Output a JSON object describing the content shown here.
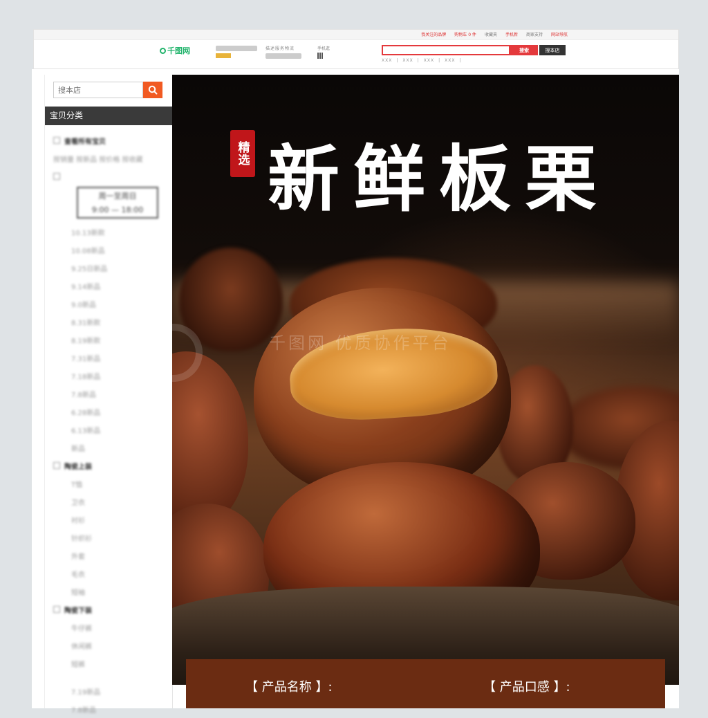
{
  "header": {
    "top_links": [
      "我关注的品牌",
      "购物车 0 件",
      "收藏夹",
      "手机新",
      "商家支持",
      "网站导航"
    ],
    "logo_text": "千图网",
    "store_service_label": "描述服务物流",
    "mobile_label": "手机逛",
    "search_placeholder": "",
    "search_button": "搜索",
    "store_search_button": "搜本店",
    "hot_words": [
      "XXX",
      "XXX",
      "XXX",
      "XXX"
    ]
  },
  "sidebar": {
    "search_placeholder": "搜本店",
    "category_title": "宝贝分类",
    "items": [
      {
        "label": "查看所有宝贝",
        "type": "head"
      },
      {
        "label": "按销量 按新品 按价格 按收藏",
        "type": "plain"
      },
      {
        "label": "",
        "type": "box"
      },
      {
        "label": "10.13新款",
        "type": "sub"
      },
      {
        "label": "10.08新品",
        "type": "sub"
      },
      {
        "label": "9.25日新品",
        "type": "sub"
      },
      {
        "label": "9.14新品",
        "type": "sub"
      },
      {
        "label": "9.0新品",
        "type": "sub"
      },
      {
        "label": "8.31新款",
        "type": "sub"
      },
      {
        "label": "8.19新款",
        "type": "sub"
      },
      {
        "label": "7.31新品",
        "type": "sub"
      },
      {
        "label": "7.18新品",
        "type": "sub"
      },
      {
        "label": "7.8新品",
        "type": "sub"
      },
      {
        "label": "6.28新品",
        "type": "sub"
      },
      {
        "label": "6.13新品",
        "type": "sub"
      },
      {
        "label": "新品",
        "type": "sub"
      },
      {
        "label": "陶瓷上装",
        "type": "head"
      },
      {
        "label": "T恤",
        "type": "sub"
      },
      {
        "label": "卫衣",
        "type": "sub"
      },
      {
        "label": "衬衫",
        "type": "sub"
      },
      {
        "label": "针织衫",
        "type": "sub"
      },
      {
        "label": "外套",
        "type": "sub"
      },
      {
        "label": "毛衣",
        "type": "sub"
      },
      {
        "label": "短袖",
        "type": "sub"
      },
      {
        "label": "陶瓷下装",
        "type": "head"
      },
      {
        "label": "牛仔裤",
        "type": "sub"
      },
      {
        "label": "休闲裤",
        "type": "sub"
      },
      {
        "label": "短裤",
        "type": "sub"
      },
      {
        "label": "",
        "type": "spacer"
      },
      {
        "label": "7.19新品",
        "type": "sub"
      },
      {
        "label": "7.8新品",
        "type": "sub"
      }
    ],
    "time_box": {
      "line1": "周一至周日",
      "line2": "9:00 — 18:00"
    }
  },
  "banner": {
    "seal_text": "精选",
    "headline": "新鲜板栗",
    "watermark": "千图网 优质协作平台",
    "product_name_label": "【 产品名称 】:",
    "product_taste_label": "【 产品口感 】:"
  },
  "colors": {
    "search_red": "#e4393c",
    "store_btn": "#f15a22",
    "category_bar": "#3a3a3a",
    "seal_red": "#c0161a",
    "info_strip": "#6b2c12",
    "logo_green": "#1fb36a"
  }
}
